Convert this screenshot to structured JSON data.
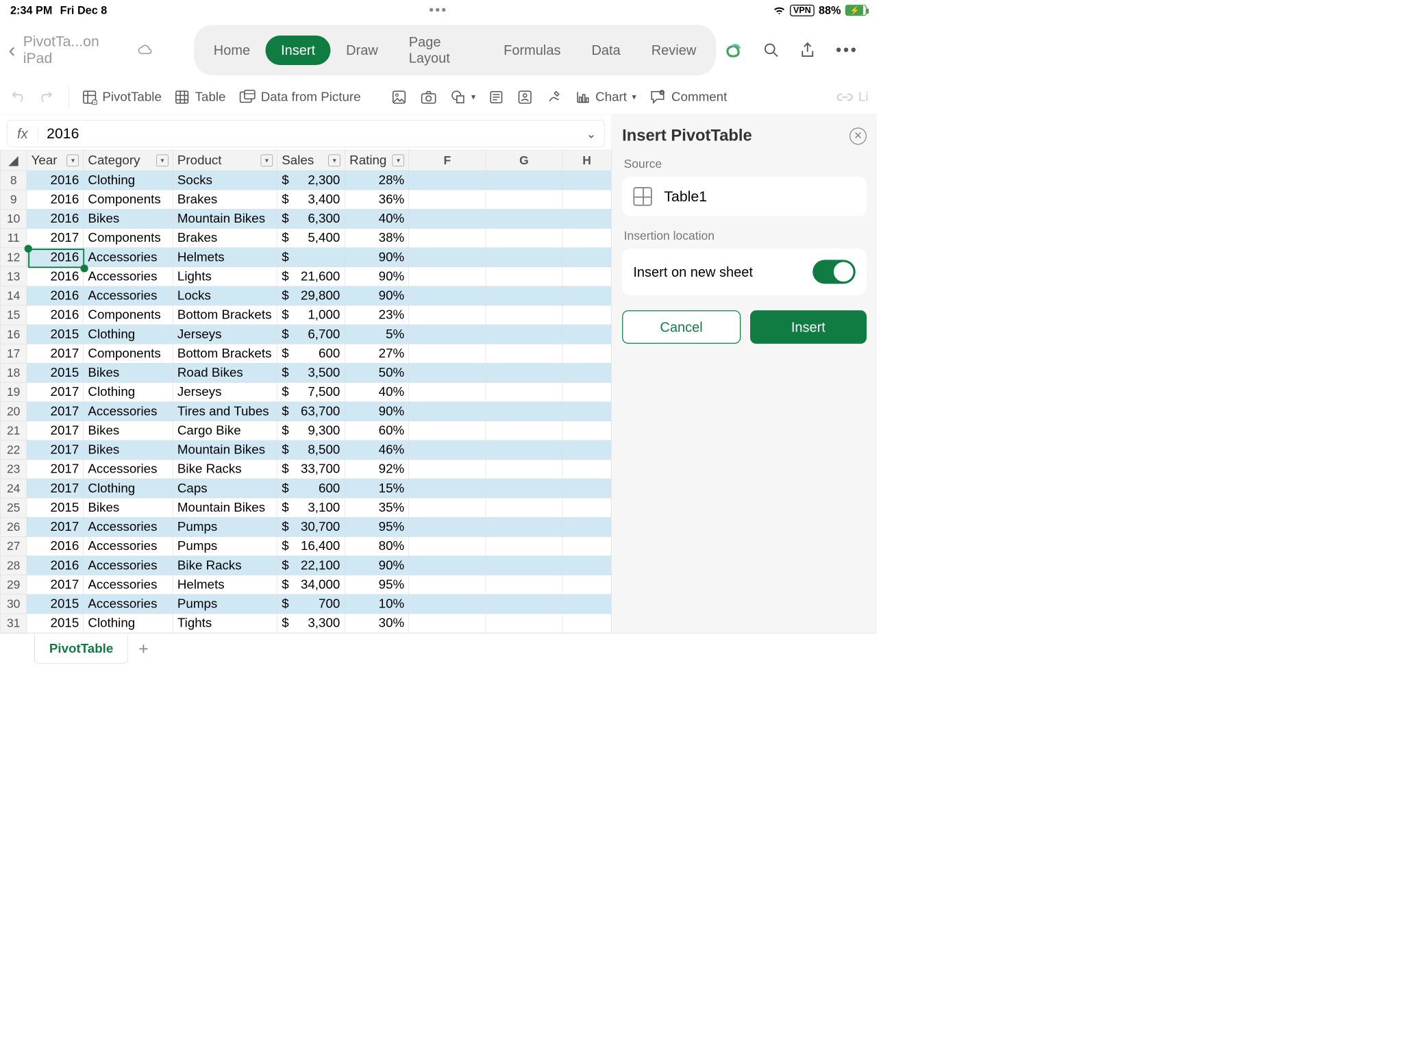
{
  "status": {
    "time": "2:34 PM",
    "date": "Fri Dec 8",
    "vpn": "VPN",
    "battery_pct": "88%"
  },
  "doc": {
    "title": "PivotTa...on iPad"
  },
  "ribbon": {
    "tabs": [
      "Home",
      "Insert",
      "Draw",
      "Page Layout",
      "Formulas",
      "Data",
      "Review"
    ],
    "active": "Insert"
  },
  "toolbar": {
    "pivottable": "PivotTable",
    "table": "Table",
    "data_from_picture": "Data from Picture",
    "chart": "Chart",
    "comment": "Comment",
    "link": "Li"
  },
  "formula": {
    "value": "2016"
  },
  "columns": {
    "headers": [
      "Year",
      "Category",
      "Product",
      "Sales",
      "Rating"
    ],
    "extra": [
      "F",
      "G",
      "H"
    ]
  },
  "rows": [
    {
      "n": 8,
      "year": "2016",
      "cat": "Clothing",
      "prod": "Socks",
      "sales": "2,300",
      "rating": "28%"
    },
    {
      "n": 9,
      "year": "2016",
      "cat": "Components",
      "prod": "Brakes",
      "sales": "3,400",
      "rating": "36%"
    },
    {
      "n": 10,
      "year": "2016",
      "cat": "Bikes",
      "prod": "Mountain Bikes",
      "sales": "6,300",
      "rating": "40%"
    },
    {
      "n": 11,
      "year": "2017",
      "cat": "Components",
      "prod": "Brakes",
      "sales": "5,400",
      "rating": "38%"
    },
    {
      "n": 12,
      "year": "2016",
      "cat": "Accessories",
      "prod": "Helmets",
      "sales": "",
      "rating": "90%"
    },
    {
      "n": 13,
      "year": "2016",
      "cat": "Accessories",
      "prod": "Lights",
      "sales": "21,600",
      "rating": "90%"
    },
    {
      "n": 14,
      "year": "2016",
      "cat": "Accessories",
      "prod": "Locks",
      "sales": "29,800",
      "rating": "90%"
    },
    {
      "n": 15,
      "year": "2016",
      "cat": "Components",
      "prod": "Bottom Brackets",
      "sales": "1,000",
      "rating": "23%"
    },
    {
      "n": 16,
      "year": "2015",
      "cat": "Clothing",
      "prod": "Jerseys",
      "sales": "6,700",
      "rating": "5%"
    },
    {
      "n": 17,
      "year": "2017",
      "cat": "Components",
      "prod": "Bottom Brackets",
      "sales": "600",
      "rating": "27%"
    },
    {
      "n": 18,
      "year": "2015",
      "cat": "Bikes",
      "prod": "Road Bikes",
      "sales": "3,500",
      "rating": "50%"
    },
    {
      "n": 19,
      "year": "2017",
      "cat": "Clothing",
      "prod": "Jerseys",
      "sales": "7,500",
      "rating": "40%"
    },
    {
      "n": 20,
      "year": "2017",
      "cat": "Accessories",
      "prod": "Tires and Tubes",
      "sales": "63,700",
      "rating": "90%"
    },
    {
      "n": 21,
      "year": "2017",
      "cat": "Bikes",
      "prod": "Cargo Bike",
      "sales": "9,300",
      "rating": "60%"
    },
    {
      "n": 22,
      "year": "2017",
      "cat": "Bikes",
      "prod": "Mountain Bikes",
      "sales": "8,500",
      "rating": "46%"
    },
    {
      "n": 23,
      "year": "2017",
      "cat": "Accessories",
      "prod": "Bike Racks",
      "sales": "33,700",
      "rating": "92%"
    },
    {
      "n": 24,
      "year": "2017",
      "cat": "Clothing",
      "prod": "Caps",
      "sales": "600",
      "rating": "15%"
    },
    {
      "n": 25,
      "year": "2015",
      "cat": "Bikes",
      "prod": "Mountain Bikes",
      "sales": "3,100",
      "rating": "35%"
    },
    {
      "n": 26,
      "year": "2017",
      "cat": "Accessories",
      "prod": "Pumps",
      "sales": "30,700",
      "rating": "95%"
    },
    {
      "n": 27,
      "year": "2016",
      "cat": "Accessories",
      "prod": "Pumps",
      "sales": "16,400",
      "rating": "80%"
    },
    {
      "n": 28,
      "year": "2016",
      "cat": "Accessories",
      "prod": "Bike Racks",
      "sales": "22,100",
      "rating": "90%"
    },
    {
      "n": 29,
      "year": "2017",
      "cat": "Accessories",
      "prod": "Helmets",
      "sales": "34,000",
      "rating": "95%"
    },
    {
      "n": 30,
      "year": "2015",
      "cat": "Accessories",
      "prod": "Pumps",
      "sales": "700",
      "rating": "10%"
    },
    {
      "n": 31,
      "year": "2015",
      "cat": "Clothing",
      "prod": "Tights",
      "sales": "3,300",
      "rating": "30%"
    }
  ],
  "panel": {
    "title": "Insert PivotTable",
    "source_label": "Source",
    "source_value": "Table1",
    "location_label": "Insertion location",
    "insert_new_sheet": "Insert on new sheet",
    "cancel": "Cancel",
    "insert": "Insert"
  },
  "sheet_tab": "PivotTable"
}
